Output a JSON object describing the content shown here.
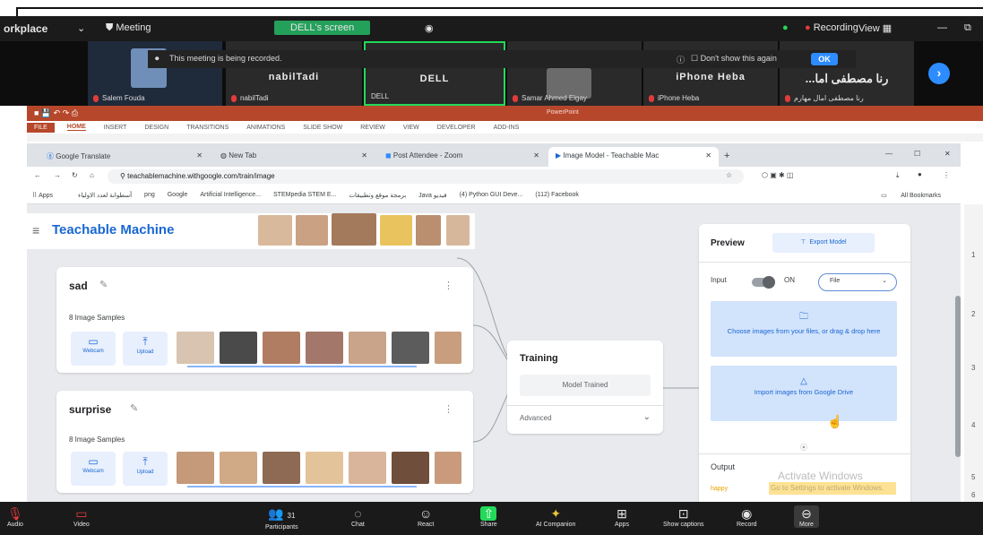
{
  "zoom": {
    "app_label": "orkplace",
    "meeting_label": "Meeting",
    "screen_label": "DELL's screen",
    "recording_label": "Recording",
    "view_label": "View",
    "banner_text": "This meeting is being recorded.",
    "dont_show_label": "Don't show this again",
    "ok_label": "OK",
    "participants": [
      {
        "big": "nabilTadi",
        "label": "Salem Fouda"
      },
      {
        "big": "DELL",
        "label": "DELL"
      },
      {
        "big": "",
        "label": "Samar Ahmed Elgay"
      },
      {
        "big": "iPhone Heba",
        "label": "iPhone Heba"
      },
      {
        "big": "...رنا مصطفى اما",
        "label": "رنا مصطفى امال مهارم"
      }
    ],
    "second_label": "nabilTadi",
    "toolbar": {
      "audio": "Audio",
      "video": "Video",
      "participants": "Participants",
      "participants_count": "31",
      "chat": "Chat",
      "react": "React",
      "share": "Share",
      "ai_companion": "AI Companion",
      "apps": "Apps",
      "captions": "Show captions",
      "record": "Record",
      "more": "More"
    }
  },
  "powerpoint": {
    "title": "PowerPoint",
    "tabs": [
      "FILE",
      "HOME",
      "INSERT",
      "DESIGN",
      "TRANSITIONS",
      "ANIMATIONS",
      "SLIDE SHOW",
      "REVIEW",
      "VIEW",
      "DEVELOPER",
      "ADD-INS"
    ]
  },
  "browser": {
    "tabs": [
      "Google Translate",
      "New Tab",
      "Post Attendee - Zoom",
      "Image Model - Teachable Mac"
    ],
    "url": "teachablemachine.withgoogle.com/train/image",
    "bookmarks": [
      "Apps",
      "أسطوانة لعدد الاولياء",
      "png",
      "Google",
      "Artificial Intelligence...",
      "STEMpedia STEM E...",
      "برمجة موقع وتطبيقات",
      "Java فيديو",
      "(4) Python GUI Deve...",
      "(112) Facebook",
      "All Bookmarks"
    ]
  },
  "teachable": {
    "title": "Teachable Machine",
    "classes": [
      {
        "name": "sad",
        "samples": "8 Image Samples",
        "webcam": "Webcam",
        "upload": "Upload"
      },
      {
        "name": "surprise",
        "samples": "8 Image Samples",
        "webcam": "Webcam",
        "upload": "Upload"
      }
    ],
    "training": {
      "title": "Training",
      "button": "Model Trained",
      "advanced": "Advanced"
    },
    "preview": {
      "title": "Preview",
      "export": "Export Model",
      "input_label": "Input",
      "toggle_state": "ON",
      "source": "File",
      "drop_files": "Choose images from your files, or drag & drop here",
      "drive": "Import images from Google Drive",
      "output_label": "Output",
      "output_class": "happy"
    }
  },
  "windows": {
    "activate_title": "Activate Windows",
    "activate_sub": "Go to Settings to activate Windows."
  },
  "ruler": [
    "1",
    "2",
    "3",
    "4",
    "5",
    "6"
  ],
  "colors": {
    "accent": "#1967d2",
    "zoom_blue": "#2d8cff",
    "ppt_red": "#b7472a",
    "recording_red": "#e23b3b"
  }
}
